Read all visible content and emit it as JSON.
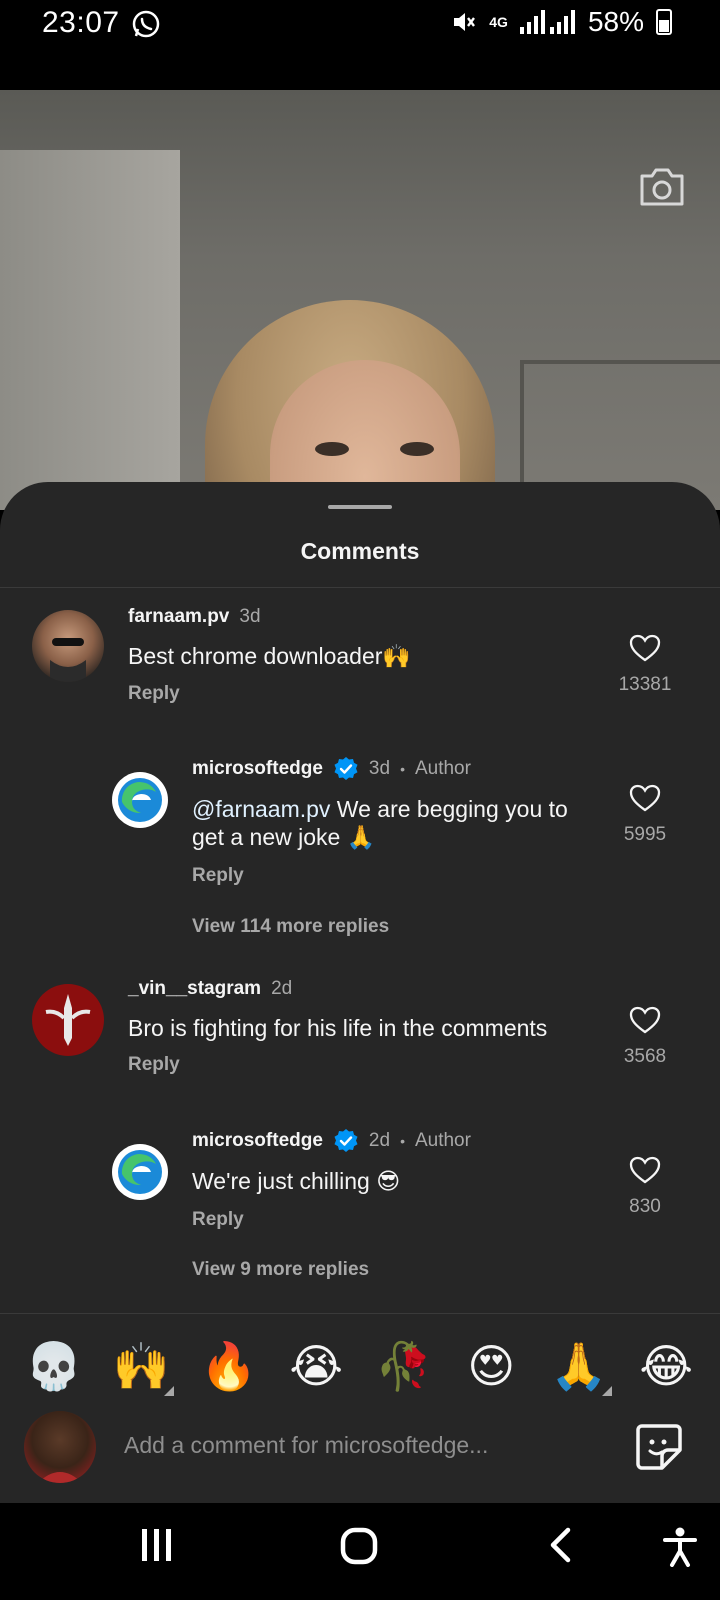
{
  "status_bar": {
    "time": "23:07",
    "network": "4G",
    "battery": "58%"
  },
  "sheet": {
    "title": "Comments"
  },
  "comments": [
    {
      "user": "farnaam.pv",
      "time": "3d",
      "text": "Best chrome downloader🙌",
      "reply_label": "Reply",
      "likes": "13381"
    },
    {
      "user": "microsoftedge",
      "time": "3d",
      "author_label": "Author",
      "mention": "@farnaam.pv",
      "text": " We are begging you to get a new joke 🙏",
      "reply_label": "Reply",
      "likes": "5995",
      "view_more": "View 114 more replies"
    },
    {
      "user": "_vin__stagram",
      "time": "2d",
      "text": "Bro is fighting for his life in the comments",
      "reply_label": "Reply",
      "likes": "3568"
    },
    {
      "user": "microsoftedge",
      "time": "2d",
      "author_label": "Author",
      "text": "We're just chilling 😎",
      "reply_label": "Reply",
      "likes": "830",
      "view_more": "View 9 more replies"
    }
  ],
  "emoji_bar": {
    "emojis": [
      "💀",
      "🙌",
      "🔥",
      "😭",
      "🥀",
      "😍",
      "🙏",
      "😂"
    ]
  },
  "compose": {
    "placeholder": "Add a comment for microsoftedge..."
  },
  "icons": {
    "camera": "camera-icon",
    "heart": "heart-icon",
    "verified": "verified-badge-icon",
    "sticker": "sticker-icon"
  },
  "colors": {
    "sheet_bg": "#262626",
    "text_primary": "#f5f5f5",
    "text_secondary": "#a8a8a8",
    "verified_blue": "#0095f6"
  }
}
